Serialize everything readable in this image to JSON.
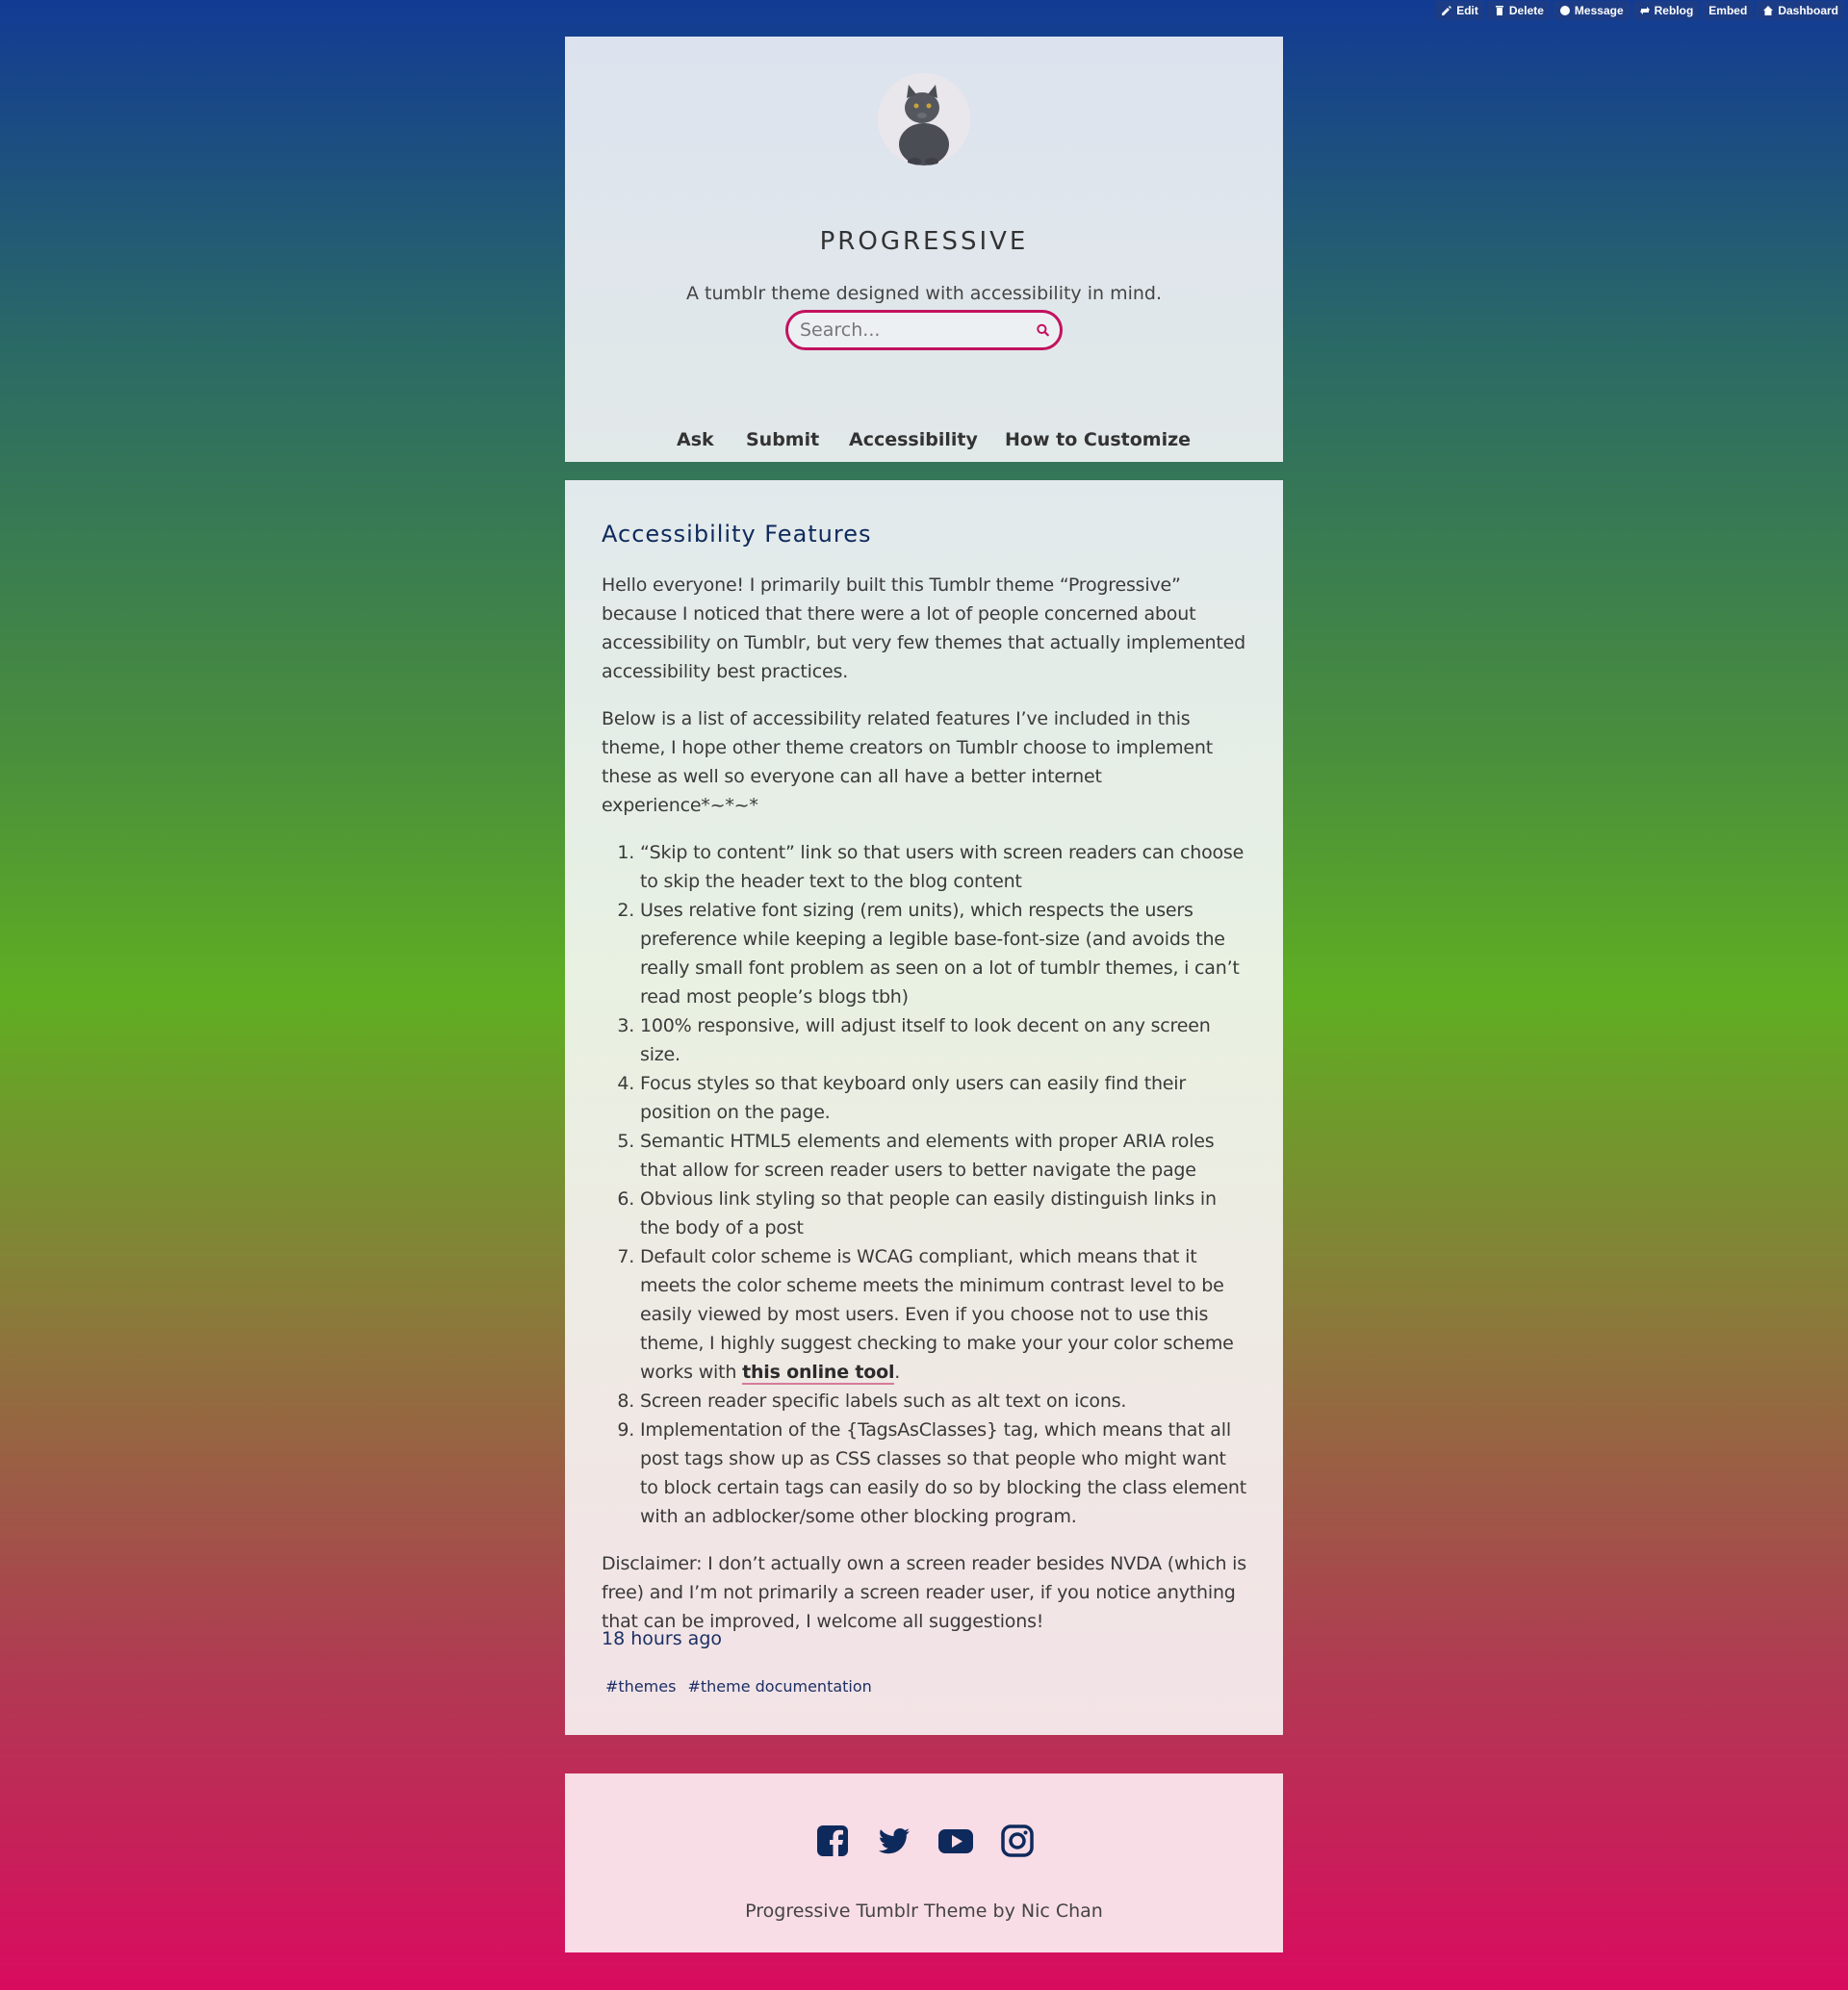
{
  "controls": {
    "edit": "Edit",
    "delete": "Delete",
    "message": "Message",
    "reblog": "Reblog",
    "embed": "Embed",
    "dashboard": "Dashboard"
  },
  "header": {
    "title": "PROGRESSIVE",
    "description": "A tumblr theme designed with accessibility in mind.",
    "search_placeholder": "Search...",
    "nav": [
      "Ask",
      "Submit",
      "Accessibility",
      "How to Customize"
    ]
  },
  "post": {
    "title": "Accessibility Features",
    "intro": "Hello everyone! I primarily built this Tumblr theme “Progressive” because I noticed that there were a lot of people concerned about accessibility on Tumblr, but very few themes that actually implemented accessibility best practices.",
    "intro2": "Below is a list of accessibility related features I’ve included in this theme, I hope other theme creators on Tumblr choose to implement these as well so everyone can all have a better internet experience*~*~*",
    "items": [
      "“Skip to content” link so that users with screen readers can choose to skip the header text to the blog content",
      "Uses relative font sizing (rem units), which respects the users preference while keeping a legible base-font-size (and avoids the really small font problem as seen on a lot of tumblr themes, i can’t read most people’s blogs tbh)",
      "100% responsive, will adjust itself to look decent on any screen size.",
      "Focus styles so that keyboard only users can easily find their position on the page.",
      "Semantic HTML5 elements and elements with proper ARIA roles that allow for screen reader users to better navigate the page",
      "Obvious link styling so that people can easily distinguish links in the body of a post",
      "Default color scheme is WCAG compliant, which means that it meets the color scheme meets the  minimum contrast level to be easily viewed by most users. Even if you choose not to use this theme, I highly suggest checking to make your your color scheme works with ",
      "Screen reader specific labels such as alt text on icons.",
      "Implementation of the {TagsAsClasses} tag, which means that all post tags show up as CSS classes so that people who might want to block certain tags can easily do so by blocking the class element with an adblocker/some other blocking program."
    ],
    "item7_link": "this online tool",
    "item7_end": ".",
    "disclaimer": "Disclaimer: I don’t actually own a screen reader besides NVDA (which is free) and I’m not primarily a screen reader user, if you notice anything that can be improved, I welcome all suggestions!",
    "timestamp": "18 hours ago",
    "tags": [
      "#themes",
      "#theme documentation"
    ]
  },
  "footer": {
    "social_icons": [
      "facebook-icon",
      "twitter-icon",
      "youtube-icon",
      "instagram-icon"
    ],
    "credit": "Progressive Tumblr Theme by Nic Chan"
  },
  "colors": {
    "accent": "#c2125f",
    "link": "#1c2f66",
    "title": "#0e2a5c"
  }
}
